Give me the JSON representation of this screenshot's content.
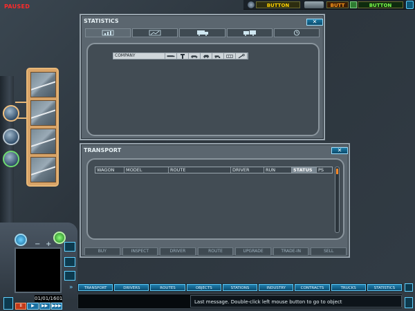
{
  "status": {
    "paused_label": "PAUSED"
  },
  "topbar": {
    "button1": "BUTTON",
    "button2": "BUTT",
    "button3": "BUTTON"
  },
  "statistics": {
    "title": "STATISTICS",
    "close": "✕",
    "tabs": [
      {
        "icon": "bar-chart-icon"
      },
      {
        "icon": "line-chart-icon"
      },
      {
        "icon": "truck-icon"
      },
      {
        "icon": "trucks-icon"
      },
      {
        "icon": "clock-icon"
      }
    ],
    "header": {
      "company": "COMPANY",
      "columns": [
        "trailer-icon",
        "tower-icon",
        "car-icon",
        "bus-icon",
        "tractor-icon",
        "solar-icon",
        "wrench-icon"
      ]
    }
  },
  "transport": {
    "title": "TRANSPORT",
    "close": "✕",
    "columns": [
      "WAGON",
      "MODEL",
      "ROUTE",
      "DRIVER",
      "RUN",
      "STATUS",
      "PS"
    ],
    "selected_column": "STATUS",
    "buttons": [
      "BUY",
      "INSPECT",
      "DRIVER",
      "ROUTE",
      "UPGRADE",
      "TRADE-IN",
      "SELL"
    ]
  },
  "control": {
    "minus": "−",
    "plus": "+",
    "date": "01/01/1601",
    "speed": [
      "II",
      "▶",
      "▶▶",
      "▶▶▶"
    ]
  },
  "nav": [
    "TRANSPORT",
    "DRIVERS",
    "ROUTES",
    "OBJECTS",
    "STATIONS",
    "INDUSTRY",
    "CONTRACTS",
    "TRUCKS",
    "STATISTICS"
  ],
  "message": "Last message. Double-click left mouse button to go to object",
  "colors": {
    "paused": "#ff2a2a",
    "accent_blue": "#1f7fb0",
    "panel_gray": "#5b666f",
    "road_panel": "#d8a468"
  }
}
